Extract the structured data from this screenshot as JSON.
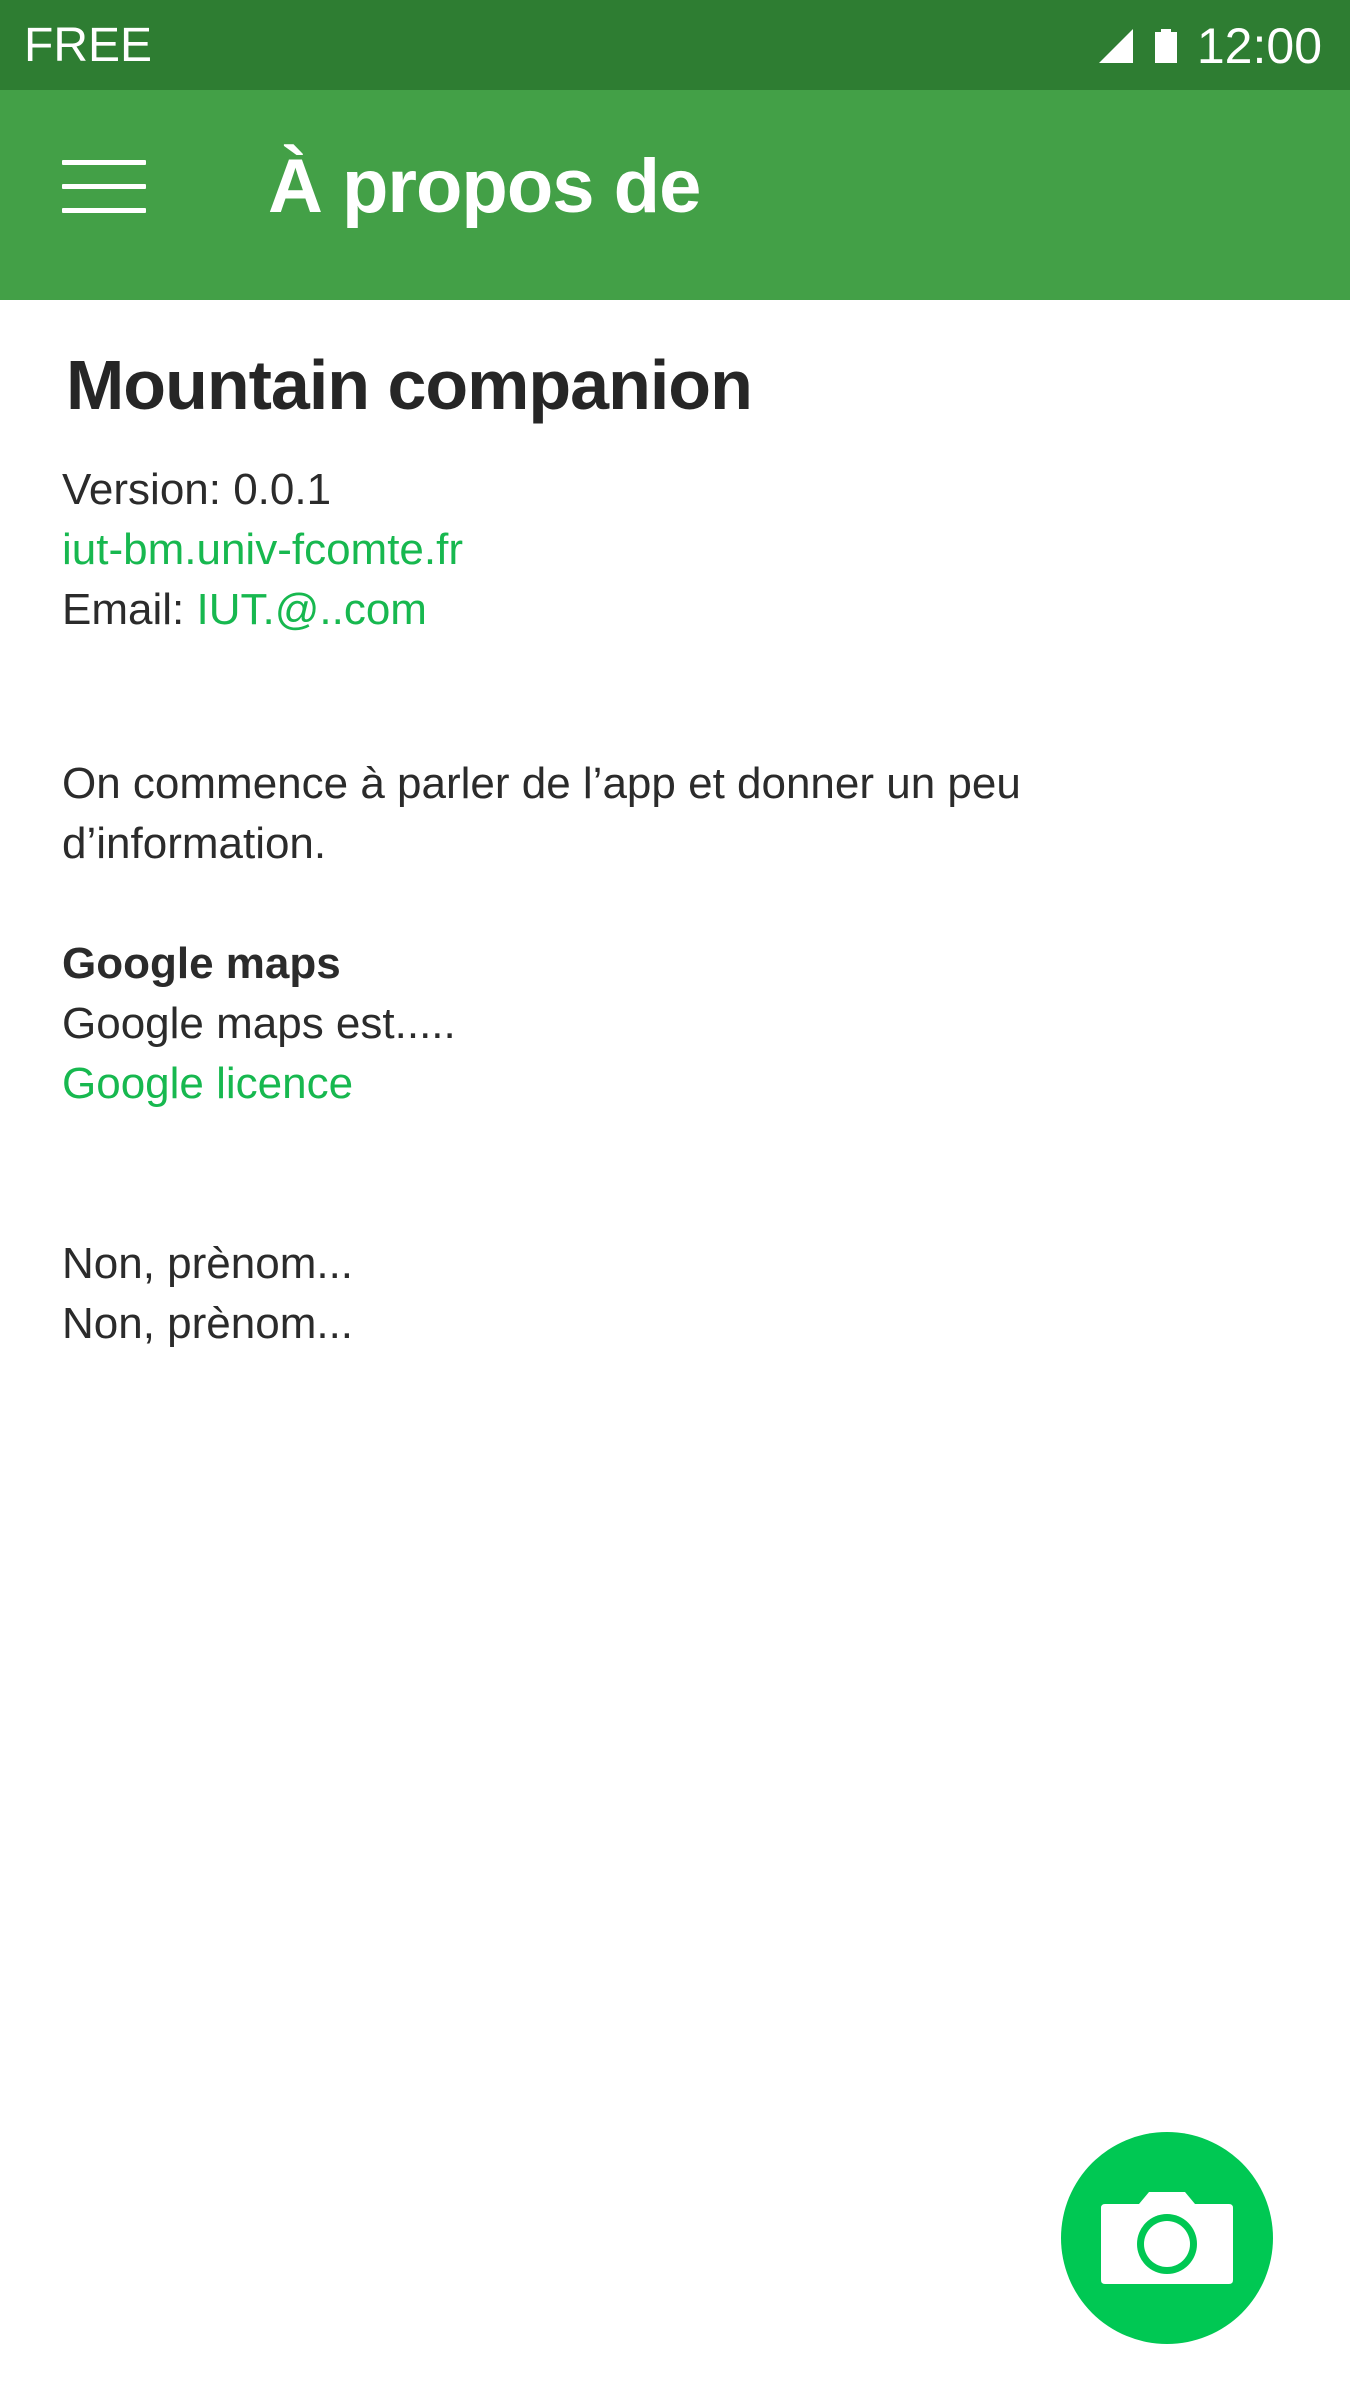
{
  "status_bar": {
    "carrier": "FREE",
    "time": "12:00",
    "icons": [
      "signal-icon",
      "battery-icon"
    ]
  },
  "app_bar": {
    "title": "À propos de",
    "menu_icon": "hamburger-menu-icon"
  },
  "about": {
    "app_name": "Mountain companion",
    "version": "Version: 0.0.1",
    "website": "iut-bm.univ-fcomte.fr",
    "email_label": "Email:",
    "email_value": "IUT.@..com",
    "description_line1": "On commence à parler de l’app et donner un peu",
    "description_line2": "d’information.",
    "section_title": "Google maps",
    "section_text": "Google maps est.....",
    "section_link": "Google licence",
    "credit_line1": "Non, prènom...",
    "credit_line2": "Non, prènom..."
  },
  "fab": {
    "icon": "camera-icon"
  },
  "colors": {
    "status_bar": "#2e7d32",
    "app_bar": "#43a047",
    "link": "#17b84f",
    "fab": "#00c853",
    "text": "#2b2b2b"
  }
}
